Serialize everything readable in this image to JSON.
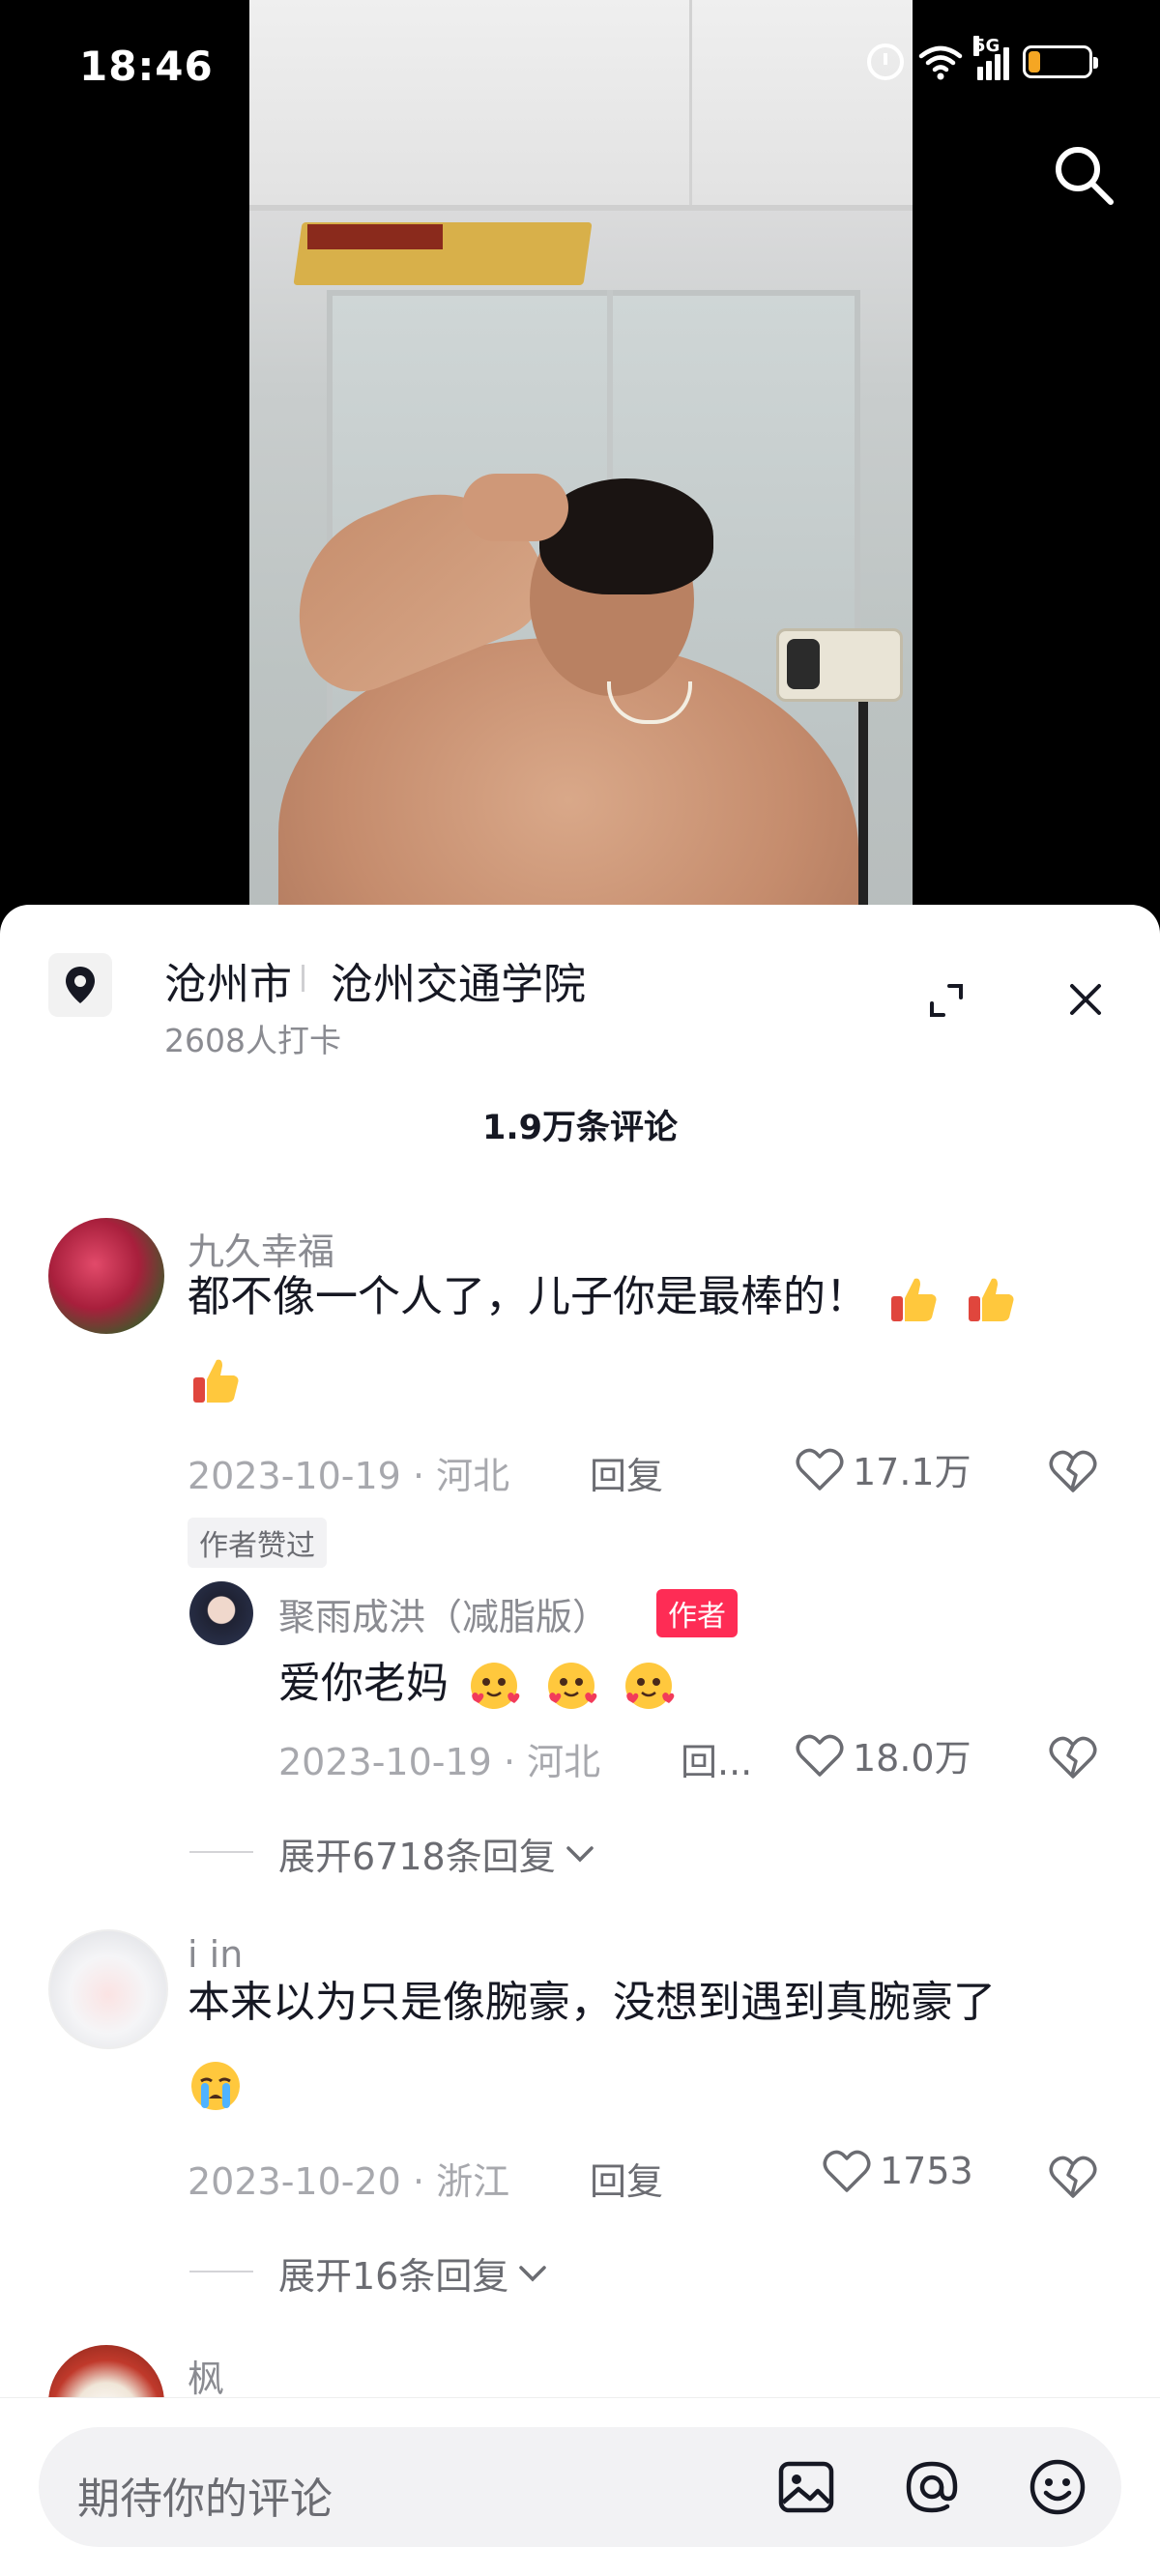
{
  "status_bar": {
    "time": "18:46",
    "network": "5G",
    "icons": [
      "alarm-icon",
      "wifi-icon",
      "signal-icon",
      "battery-icon"
    ],
    "battery_color": "#f5a623"
  },
  "video": {
    "search_icon": "search-icon"
  },
  "location": {
    "icon": "location-pin-icon",
    "city": "沧州市",
    "place": "沧州交通学院",
    "checkins": "2608人打卡"
  },
  "panel": {
    "comment_count": "1.9万条评论",
    "expand_icon": "expand-icon",
    "close_icon": "close-icon"
  },
  "comments": [
    {
      "name": "九久幸福",
      "text": "都不像一个人了，儿子你是最棒的！",
      "emojis": [
        "thumbs-up-icon",
        "thumbs-up-icon",
        "thumbs-up-icon"
      ],
      "date": "2023-10-19",
      "region": "河北",
      "reply_label": "回复",
      "likes": "17.1万",
      "badge": "作者赞过",
      "reply": {
        "name": "聚雨成洪（减脂版）",
        "tag": "作者",
        "text": "爱你老妈",
        "emojis": [
          "hearts-face-icon",
          "hearts-face-icon",
          "hearts-face-icon"
        ],
        "date": "2023-10-19",
        "region": "河北",
        "reply_label": "回...",
        "likes": "18.0万"
      },
      "expand_label": "展开6718条回复"
    },
    {
      "name": "i in",
      "text": "本来以为只是像腕豪，没想到遇到真腕豪了",
      "emojis": [
        "crying-face-icon"
      ],
      "date": "2023-10-20",
      "region": "浙江",
      "reply_label": "回复",
      "likes": "1753",
      "expand_label": "展开16条回复"
    },
    {
      "name": "枫"
    }
  ],
  "input": {
    "placeholder": "期待你的评论",
    "icons": [
      "image-icon",
      "at-icon",
      "emoji-icon"
    ]
  },
  "colors": {
    "author_tag": "#fe2c55",
    "text_primary": "#161823",
    "text_secondary": "#8a8b91"
  }
}
